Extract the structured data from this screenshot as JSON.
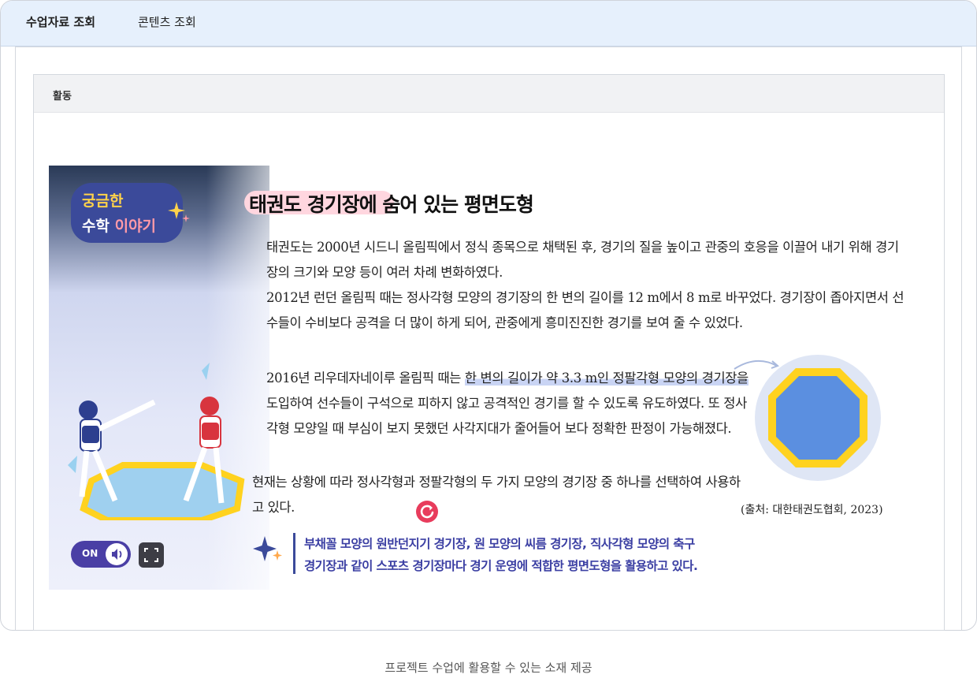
{
  "tabs": [
    {
      "label": "수업자료 조회",
      "active": true
    },
    {
      "label": "콘텐츠 조회",
      "active": false
    }
  ],
  "panel": {
    "title": "활동"
  },
  "slide": {
    "series_badge": {
      "line1": "궁금한",
      "line2a": "수학",
      "line2b": "이야기"
    },
    "heading": "태권도 경기장에 숨어 있는 평면도형",
    "paragraphs": {
      "p1": "태권도는 2000년 시드니 올림픽에서 정식 종목으로 채택된 후, 경기의 질을 높이고 관중의 호응을 이끌어 내기 위해 경기장의 크기와 모양 등이 여러 차례 변화하였다.",
      "p2": "2012년 런던 올림픽 때는 정사각형 모양의 경기장의 한 변의 길이를 12 m에서 8 m로 바꾸었다. 경기장이 좁아지면서 선수들이 수비보다 공격을 더 많이 하게 되어, 관중에게 흥미진진한 경기를 보여 줄 수 있었다.",
      "p3_pre": "2016년 리우데자네이루 올림픽 때는 ",
      "p3_hl": "한 변의 길이가 약 3.3 m인 정팔각형 모양의 경기장을",
      "p3_post": " 도입하여 선수들이 구석으로 피하지 않고 공격적인 경기를 할 수 있도록 유도하였다. 또 정사각형 모양일 때 부심이 보지 못했던 사각지대가 줄어들어 보다 정확한 판정이 가능해졌다.",
      "p4": "현재는 상황에 따라 정사각형과 정팔각형의 두 가지 모양의 경기장 중 하나를 선택하여 사용하고 있다."
    },
    "source": "(출처: 대한태권도협회, 2023)",
    "tip_line1": "부채꼴 모양의 원반던지기 경기장, 원 모양의 씨름 경기장, 직사각형 모양의 축구",
    "tip_line2": "경기장과 같이 스포츠 경기장마다 경기 운영에 적합한 평면도형을 활용하고 있다.",
    "audio_toggle": {
      "label": "ON",
      "state": "on"
    },
    "icons": {
      "sparkle": "sparkle-icon",
      "refresh": "refresh-icon",
      "speaker": "speaker-icon",
      "fullscreen": "fullscreen-icon"
    }
  },
  "caption": "프로젝트 수업에 활용할 수 있는 소재 제공",
  "colors": {
    "tabbar_bg": "#e6f0fc",
    "badge_bg": "#3b4a9a",
    "heading_highlight": "#ffd6df",
    "text_highlight": "#c9d4f4",
    "octagon_fill": "#5b8fe0",
    "octagon_border": "#ffd21f",
    "refresh_btn": "#e83c5c",
    "toggle_bg": "#4a3fa5",
    "tip_text": "#3b3fa3"
  }
}
